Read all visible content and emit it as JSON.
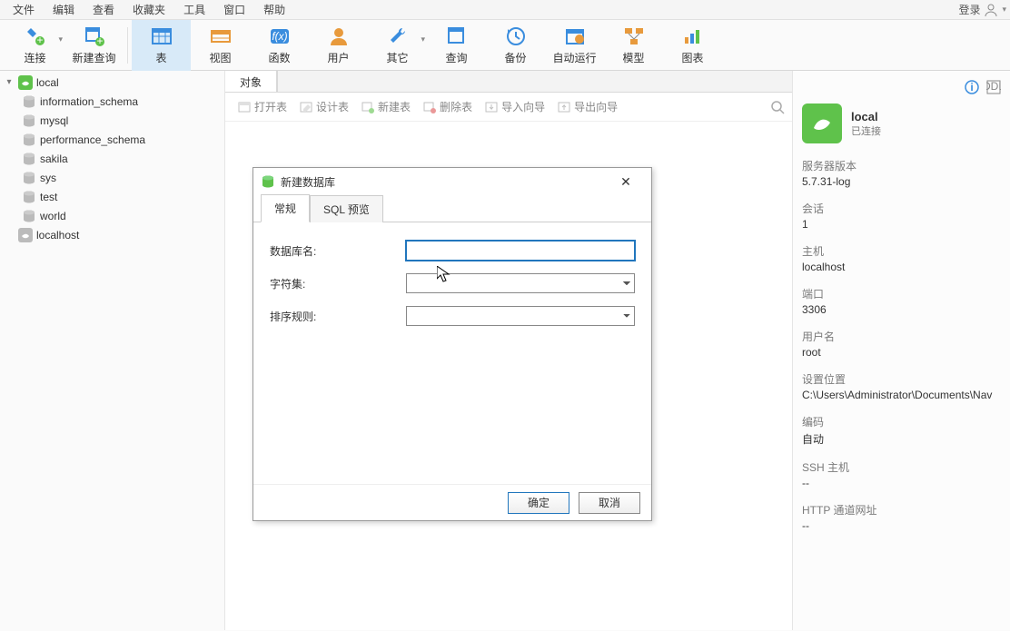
{
  "menu": {
    "items": [
      "文件",
      "编辑",
      "查看",
      "收藏夹",
      "工具",
      "窗口",
      "帮助"
    ],
    "right": "登录"
  },
  "toolbar": {
    "connect": "连接",
    "new_query": "新建查询",
    "table": "表",
    "view": "视图",
    "function": "函数",
    "user": "用户",
    "other": "其它",
    "query": "查询",
    "backup": "备份",
    "autorun": "自动运行",
    "model": "模型",
    "chart": "图表"
  },
  "tree": {
    "conn1": "local",
    "dbs": [
      "information_schema",
      "mysql",
      "performance_schema",
      "sakila",
      "sys",
      "test",
      "world"
    ],
    "conn2": "localhost"
  },
  "center": {
    "tab": "对象",
    "sub": {
      "open": "打开表",
      "design": "设计表",
      "new": "新建表",
      "delete": "删除表",
      "import": "导入向导",
      "export": "导出向导"
    }
  },
  "info": {
    "conn_name": "local",
    "conn_status": "已连接",
    "server_ver_k": "服务器版本",
    "server_ver_v": "5.7.31-log",
    "session_k": "会话",
    "session_v": "1",
    "host_k": "主机",
    "host_v": "localhost",
    "port_k": "端口",
    "port_v": "3306",
    "user_k": "用户名",
    "user_v": "root",
    "loc_k": "设置位置",
    "loc_v": "C:\\Users\\Administrator\\Documents\\Nav",
    "enc_k": "编码",
    "enc_v": "自动",
    "ssh_k": "SSH 主机",
    "ssh_v": "--",
    "http_k": "HTTP 通道网址",
    "http_v": "--"
  },
  "dialog": {
    "title": "新建数据库",
    "tab_general": "常规",
    "tab_sql": "SQL 预览",
    "db_name_label": "数据库名:",
    "charset_label": "字符集:",
    "collation_label": "排序规则:",
    "db_name_value": "",
    "charset_value": "",
    "collation_value": "",
    "ok": "确定",
    "cancel": "取消"
  }
}
